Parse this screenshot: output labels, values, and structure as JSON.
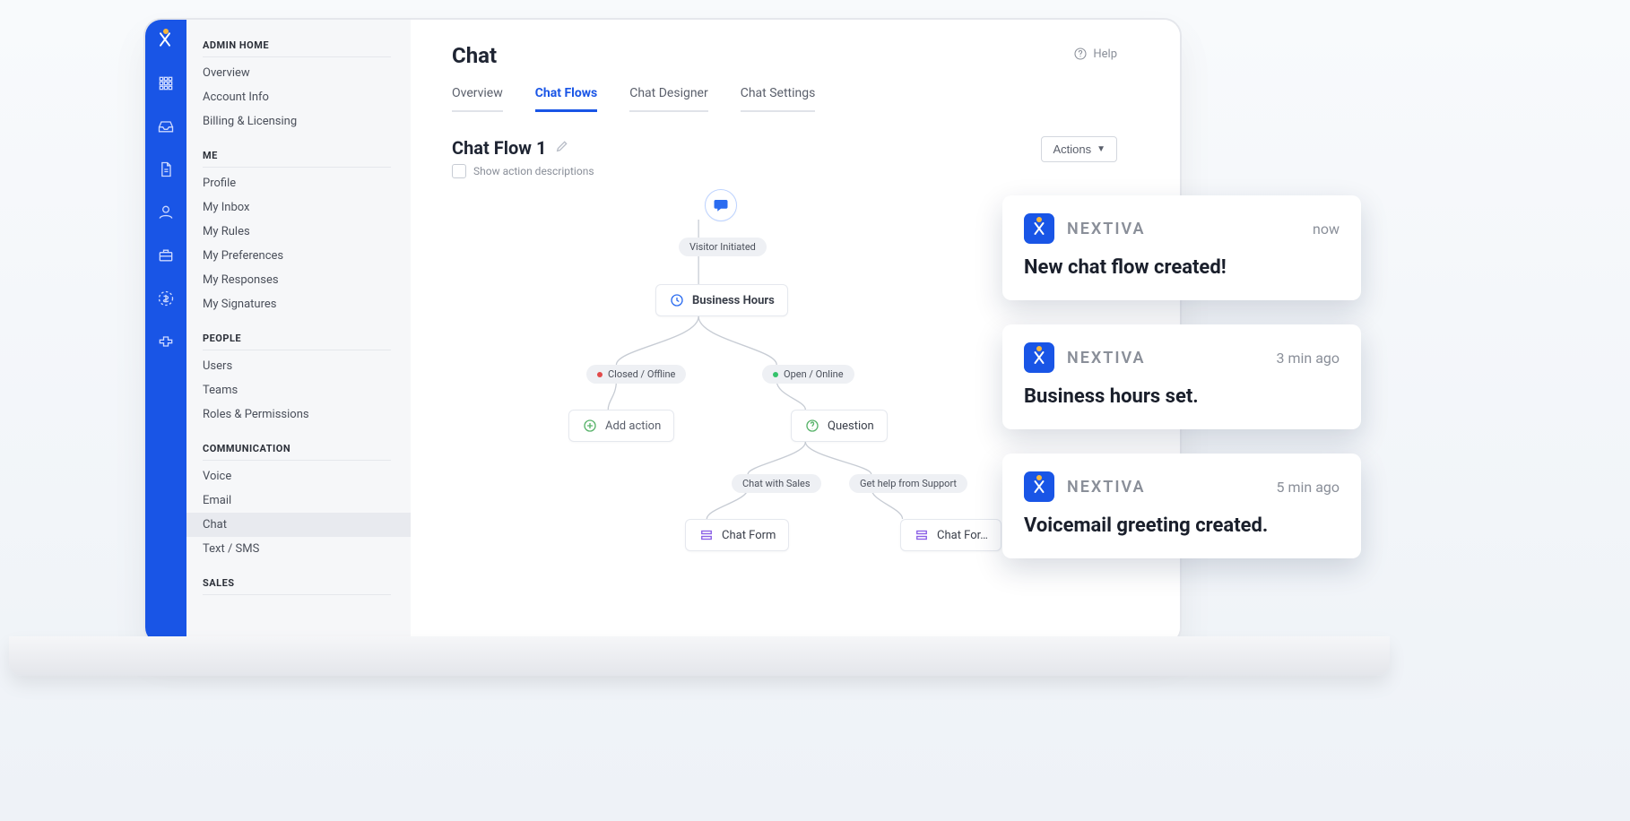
{
  "iconrail": {
    "items": [
      "apps",
      "inbox",
      "document",
      "user",
      "briefcase",
      "currency",
      "integrations"
    ]
  },
  "sidebar": {
    "groups": [
      {
        "title": "ADMIN HOME",
        "items": [
          "Overview",
          "Account Info",
          "Billing & Licensing"
        ]
      },
      {
        "title": "ME",
        "items": [
          "Profile",
          "My Inbox",
          "My Rules",
          "My Preferences",
          "My Responses",
          "My Signatures"
        ]
      },
      {
        "title": "PEOPLE",
        "items": [
          "Users",
          "Teams",
          "Roles & Permissions"
        ]
      },
      {
        "title": "COMMUNICATION",
        "items": [
          "Voice",
          "Email",
          "Chat",
          "Text / SMS"
        ],
        "active": "Chat"
      },
      {
        "title": "SALES",
        "items": []
      }
    ]
  },
  "header": {
    "title": "Chat",
    "help": "Help"
  },
  "tabs": {
    "items": [
      "Overview",
      "Chat Flows",
      "Chat Designer",
      "Chat Settings"
    ],
    "active": "Chat Flows"
  },
  "flow": {
    "name": "Chat Flow 1",
    "show_desc_label": "Show action descriptions",
    "actions_label": "Actions",
    "nodes": {
      "visitor_initiated": "Visitor Initiated",
      "business_hours": "Business Hours",
      "closed": "Closed / Offline",
      "open": "Open / Online",
      "add_action": "Add action",
      "question": "Question",
      "chat_sales": "Chat with Sales",
      "help_support": "Get help from Support",
      "chat_form_left": "Chat Form",
      "chat_form_right": "Chat For…"
    }
  },
  "toasts": [
    {
      "brand": "NEXTIVA",
      "time": "now",
      "msg": "New chat flow created!"
    },
    {
      "brand": "NEXTIVA",
      "time": "3 min ago",
      "msg": "Business hours set."
    },
    {
      "brand": "NEXTIVA",
      "time": "5 min ago",
      "msg": "Voicemail greeting created."
    }
  ]
}
